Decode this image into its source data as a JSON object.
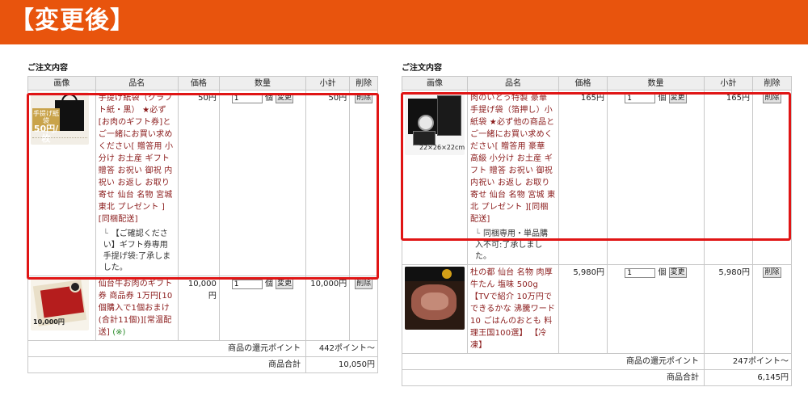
{
  "banner": {
    "title": "【変更後】"
  },
  "section_title": "ご注文内容",
  "table_headers": {
    "image": "画像",
    "name": "品名",
    "price": "価格",
    "qty": "数量",
    "subtotal": "小計",
    "delete": "削除"
  },
  "qty_unit": "個",
  "change_button": "変更",
  "delete_button": "削除",
  "left": {
    "items": [
      {
        "thumb_badge_top": "手提げ紙袋",
        "thumb_badge_price": "50円/枚",
        "name": "手提げ紙袋（クラフト紙・黒） ★必ず[お肉のギフト券]とご一緒にお買い求めください[ 贈答用 小分け お土産 ギフト 贈答 お祝い 御祝 内祝い お返し お取り寄せ 仙台 名物 宮城 東北 プレゼント ][同梱配送]",
        "note": "",
        "option": "【ご確認ください】ギフト券専用手提げ袋:了承しました。",
        "price": "50円",
        "qty": "1",
        "subtotal": "50円"
      },
      {
        "thumb_text": "10,000円",
        "name": "仙台牛お肉のギフト券 商品券 1万円[10個購入で1個おまけ(合計11個)][常温配送]",
        "note": "(※)",
        "option": "",
        "price": "10,000円",
        "qty": "1",
        "subtotal": "10,000円"
      }
    ],
    "points_label": "商品の還元ポイント",
    "points_value": "442ポイント～",
    "total_label": "商品合計",
    "total_value": "10,050円"
  },
  "right": {
    "items": [
      {
        "thumb_text": "22×26×22cm",
        "name": "肉のいとう特製 豪華 手提げ袋（箔押し）小 紙袋 ★必ず他の商品とご一緒にお買い求めください[ 贈答用 豪華 高級 小分け お土産 ギフト 贈答 お祝い 御祝 内祝い お返し お取り寄せ 仙台 名物 宮城 東北 プレゼント ][同梱配送]",
        "option": "同梱専用・単品購入不可:了承しました。",
        "price": "165円",
        "qty": "1",
        "subtotal": "165円"
      },
      {
        "name": "杜の都 仙台 名物 肉厚牛たん 塩味 500g【TVで紹介 10万円でできるかな 沸騰ワード10 ごはんのおとも 料理王国100選】 【冷凍】",
        "option": "",
        "price": "5,980円",
        "qty": "1",
        "subtotal": "5,980円"
      }
    ],
    "points_label": "商品の還元ポイント",
    "points_value": "247ポイント～",
    "total_label": "商品合計",
    "total_value": "6,145円"
  },
  "colors": {
    "banner": "#e8540d",
    "highlight": "#e01515",
    "product_name": "#8a1a1a",
    "note": "#2a8a2a"
  }
}
